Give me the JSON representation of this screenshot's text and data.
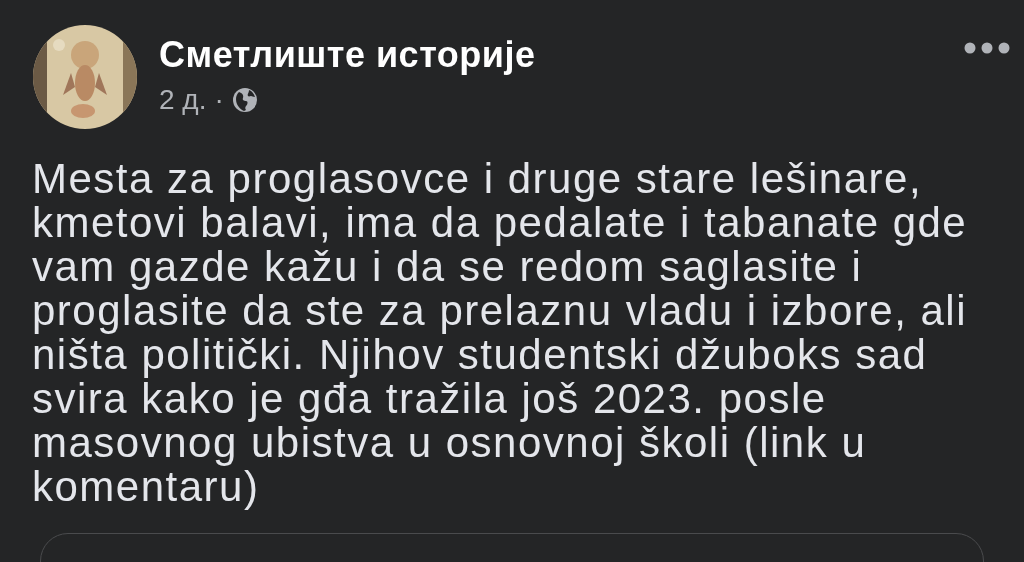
{
  "post": {
    "author": "Сметлиште историје",
    "time": "2 д.",
    "separator": "·",
    "text": "Mesta za proglasovce i druge stare lešinare, kmetovi balavi, ima da pedalate i tabanate gde vam gazde kažu i da se redom saglasite i proglasite da ste za prelaznu vladu i izbore, ali ništa politički. Njihov studentski džuboks sad svira kako je gđa tražila još 2023. posle masovnog ubistva u osnovnoj školi (link u komentaru)"
  }
}
